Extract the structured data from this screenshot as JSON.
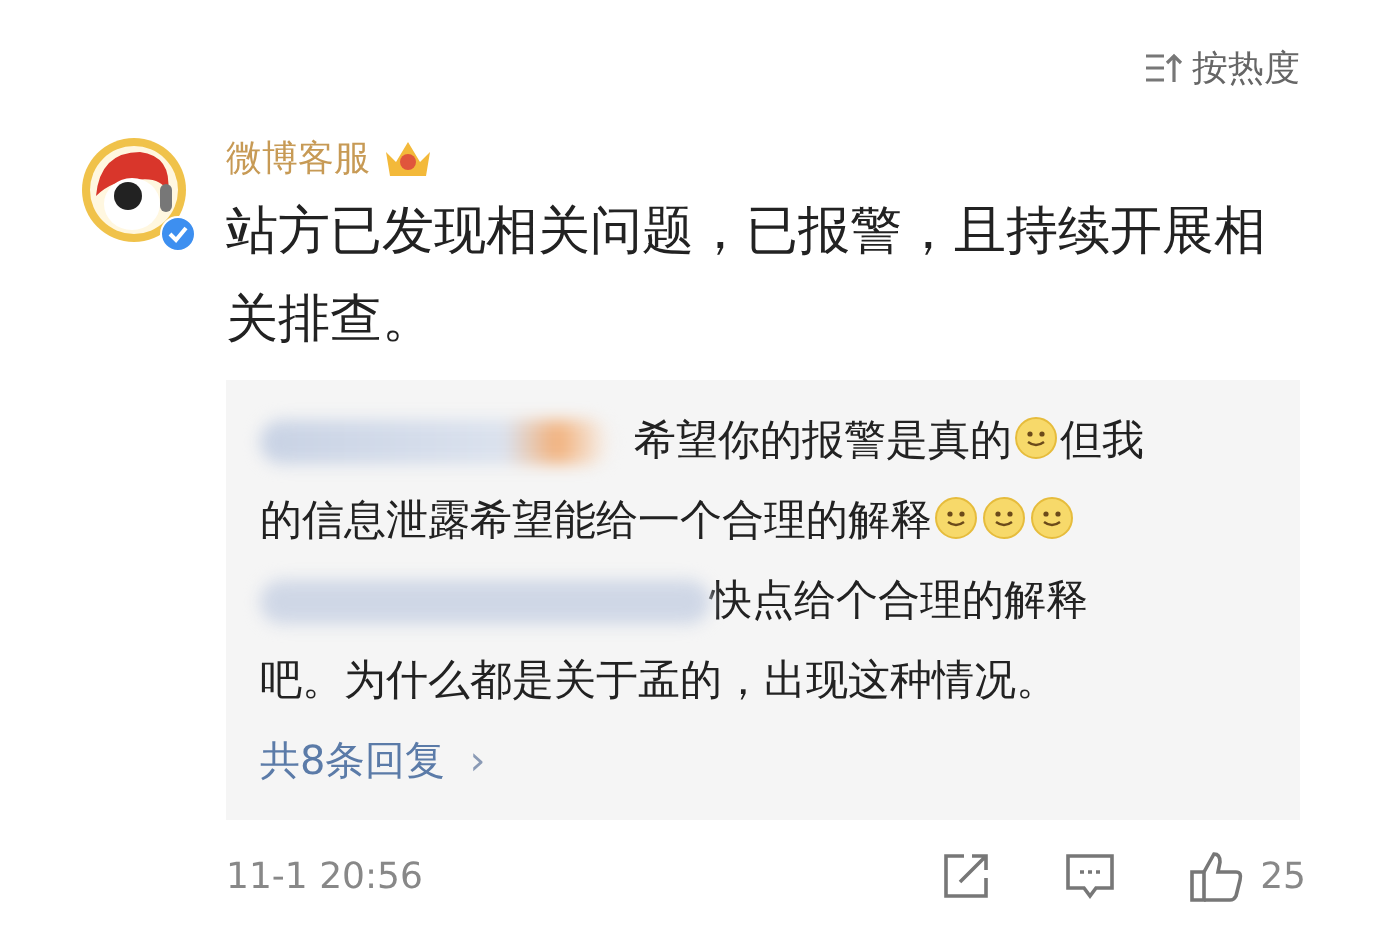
{
  "sort": {
    "label": "按热度"
  },
  "comment": {
    "author": "微博客服",
    "verified": true,
    "text": "站方已发现相关问题，已报警，且持续开展相关排查。",
    "replies": [
      {
        "name_blurred": true,
        "parts": [
          {
            "kind": "text",
            "text": "希望你的报警是真的"
          },
          {
            "kind": "emoji"
          },
          {
            "kind": "text",
            "text": "但我的信息泄露希望能给一个合理的解释"
          },
          {
            "kind": "emoji"
          },
          {
            "kind": "emoji"
          },
          {
            "kind": "emoji"
          }
        ]
      },
      {
        "name_blurred": true,
        "parts": [
          {
            "kind": "text",
            "text": "快点给个合理的解释吧。为什么都是关于孟的，出现这种情况。"
          }
        ]
      }
    ],
    "more_replies": "共8条回复",
    "more_arrow": "›",
    "time": "11-1 20:56",
    "likes": "25"
  }
}
